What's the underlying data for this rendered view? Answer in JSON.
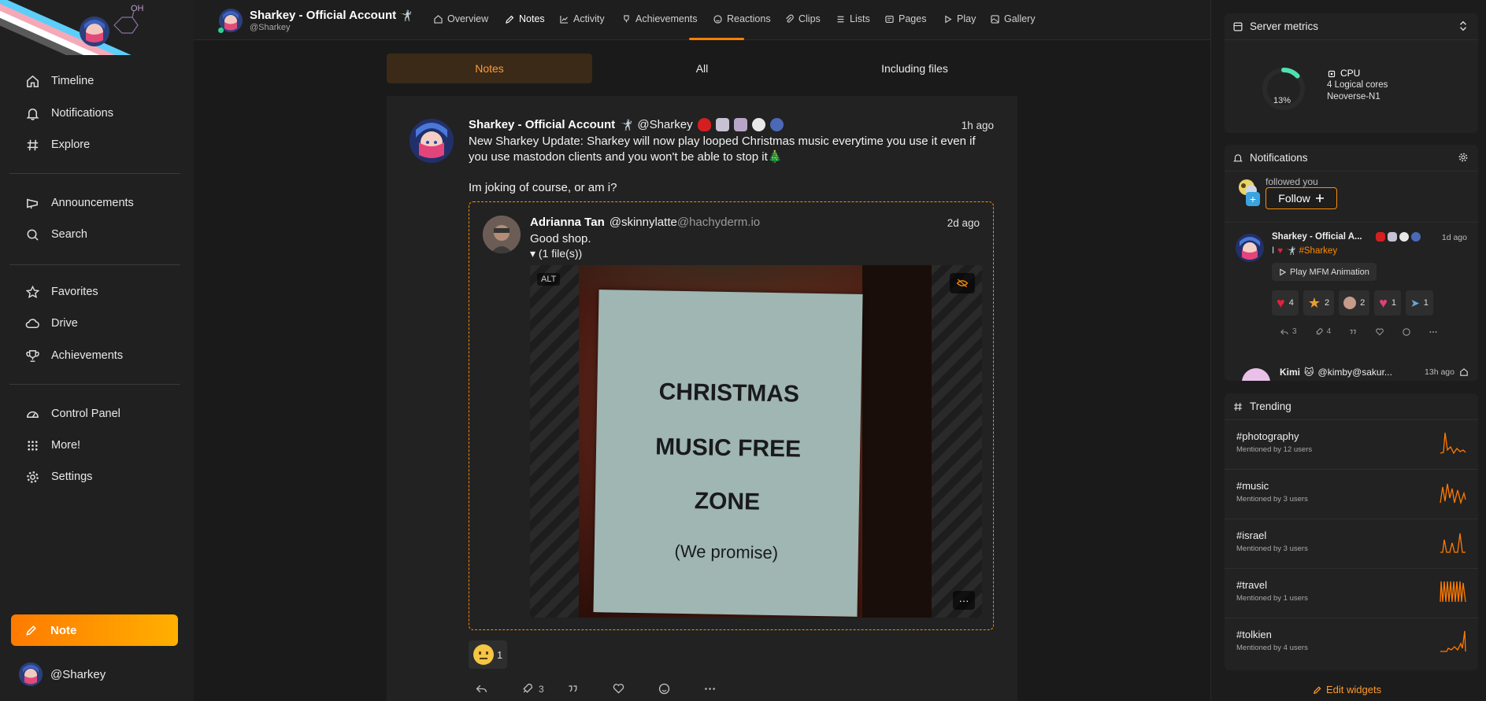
{
  "sidebar": {
    "logo_label": "OH",
    "nav": [
      {
        "label": "Timeline",
        "icon": "home-icon"
      },
      {
        "label": "Notifications",
        "icon": "bell-icon"
      },
      {
        "label": "Explore",
        "icon": "hash-icon"
      },
      {
        "label": "Announcements",
        "icon": "megaphone-icon"
      },
      {
        "label": "Search",
        "icon": "search-icon"
      },
      {
        "label": "Favorites",
        "icon": "star-icon"
      },
      {
        "label": "Drive",
        "icon": "cloud-icon"
      },
      {
        "label": "Achievements",
        "icon": "trophy-icon"
      },
      {
        "label": "Control Panel",
        "icon": "dashboard-icon"
      },
      {
        "label": "More!",
        "icon": "grid-dots-icon"
      },
      {
        "label": "Settings",
        "icon": "gear-icon"
      }
    ],
    "note_button": "Note",
    "me_handle": "@Sharkey"
  },
  "header": {
    "name": "Sharkey - Official Account",
    "handle": "@Sharkey",
    "tabs": [
      "Overview",
      "Notes",
      "Activity",
      "Achievements",
      "Reactions",
      "Clips",
      "Lists",
      "Pages",
      "Play",
      "Gallery"
    ],
    "active_tab": "Notes"
  },
  "subtabs": [
    "Notes",
    "All",
    "Including files"
  ],
  "note": {
    "author_name": "Sharkey - Official Account",
    "author_handle": "@Sharkey",
    "time": "1h ago",
    "text": "New Sharkey Update: Sharkey will now play looped Christmas music everytime you use it even if you use mastodon clients and you won't be able to stop it",
    "text2": "Im joking of course, or am i?",
    "quote": {
      "author_name": "Adrianna Tan",
      "author_handle": "@skinnylatte",
      "author_host": "@hachyderm.io",
      "time": "2d ago",
      "text": "Good shop.",
      "files": "▾ (1 file(s))",
      "alt": "ALT",
      "sign_lines": [
        "CHRISTMAS",
        "MUSIC FREE",
        "ZONE",
        "(We promise)"
      ]
    },
    "reaction_count": "1",
    "renote_count": "3"
  },
  "widgets": {
    "metrics": {
      "title": "Server metrics",
      "cpu_percent": 13,
      "cpu_percent_label": "13%",
      "cpu_title": "CPU",
      "cpu_cores": "4 Logical cores",
      "cpu_model": "Neoverse-N1"
    },
    "notifications": {
      "title": "Notifications",
      "followed_text": "followed you",
      "follow_button": "Follow",
      "n2_name": "Sharkey - Official A...",
      "n2_time": "1d ago",
      "n2_text_prefix": "I",
      "n2_tag": "#Sharkey",
      "mfm_button": "Play MFM Animation",
      "reactions": [
        "4",
        "2",
        "2",
        "1",
        "1"
      ],
      "n2_renotes": "3",
      "n2_boosts": "4",
      "n3_name": "Kimi",
      "n3_handle": "@kimby@sakur...",
      "n3_time": "13h ago"
    },
    "trending": {
      "title": "Trending",
      "items": [
        {
          "tag": "#photography",
          "meta": "Mentioned by 12 users"
        },
        {
          "tag": "#music",
          "meta": "Mentioned by 3 users"
        },
        {
          "tag": "#israel",
          "meta": "Mentioned by 3 users"
        },
        {
          "tag": "#travel",
          "meta": "Mentioned by 1 users"
        },
        {
          "tag": "#tolkien",
          "meta": "Mentioned by 4 users"
        }
      ]
    },
    "edit_label": "Edit widgets"
  },
  "colors": {
    "accent": "#ff8a00",
    "sidebar_bg": "#202020",
    "main_bg": "#1a1a1a",
    "card_bg": "#222222"
  }
}
